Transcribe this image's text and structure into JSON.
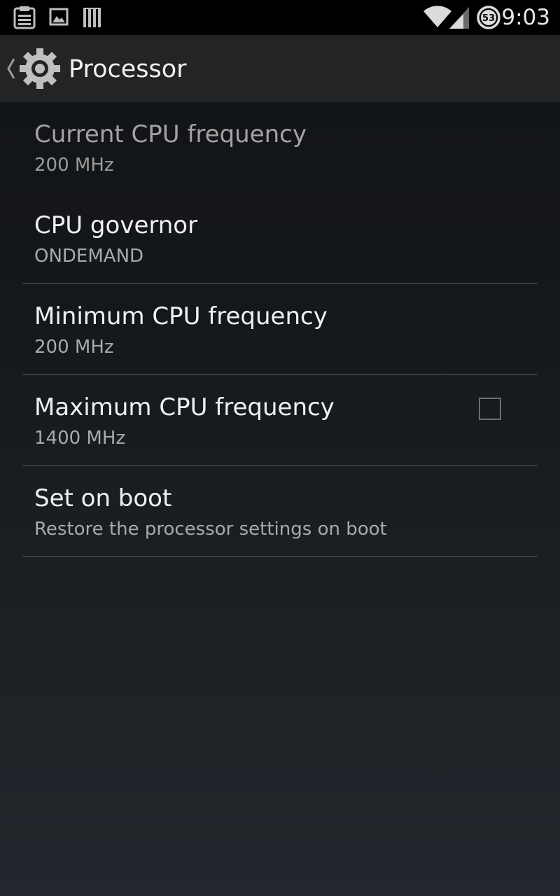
{
  "status_bar": {
    "left_icons": [
      "clipboard-icon",
      "image-icon",
      "barcode-icon"
    ],
    "right_icons": [
      "wifi-icon",
      "cell-signal-icon",
      "battery-icon"
    ],
    "battery_level": "53",
    "time": "9:03"
  },
  "action_bar": {
    "up_icon": "back-caret-icon",
    "app_icon": "settings-gear-icon",
    "title": "Processor"
  },
  "preferences": [
    {
      "title": "Current CPU frequency",
      "summary": "200 MHz",
      "enabled": false
    },
    {
      "title": "CPU governor",
      "summary": "ONDEMAND",
      "enabled": true
    },
    {
      "title": "Minimum CPU frequency",
      "summary": "200 MHz",
      "enabled": true
    },
    {
      "title": "Maximum CPU frequency",
      "summary": "1400 MHz",
      "enabled": true
    },
    {
      "title": "Set on boot",
      "summary": "Restore the processor settings on boot",
      "enabled": true,
      "checkbox": false
    }
  ],
  "colors": {
    "status_bar_bg": "#000000",
    "action_bar_bg": "#222426",
    "title_text": "#f0f0f0",
    "summary_text": "#a9a9a9",
    "divider": "#3a3c3e"
  }
}
